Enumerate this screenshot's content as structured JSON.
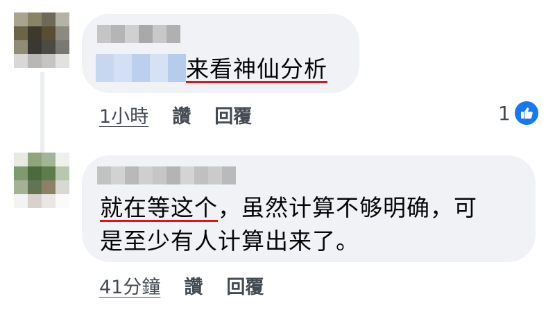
{
  "comments": [
    {
      "text_tagged": "来看神仙分析",
      "text_rest": "",
      "time": "1小時",
      "like_label": "讚",
      "reply_label": "回覆",
      "reaction_count": "1"
    },
    {
      "text_tagged": "就在等这个",
      "text_rest": "，虽然计算不够明确，可",
      "text_line2": "是至少有人计算出来了。",
      "time": "41分鐘",
      "like_label": "讚",
      "reply_label": "回覆"
    }
  ],
  "icons": {
    "like": "thumbs-up-icon"
  },
  "colors": {
    "bubble": "#f0f2f5",
    "underline": "#e0121c",
    "like_badge": "#1877f2"
  }
}
